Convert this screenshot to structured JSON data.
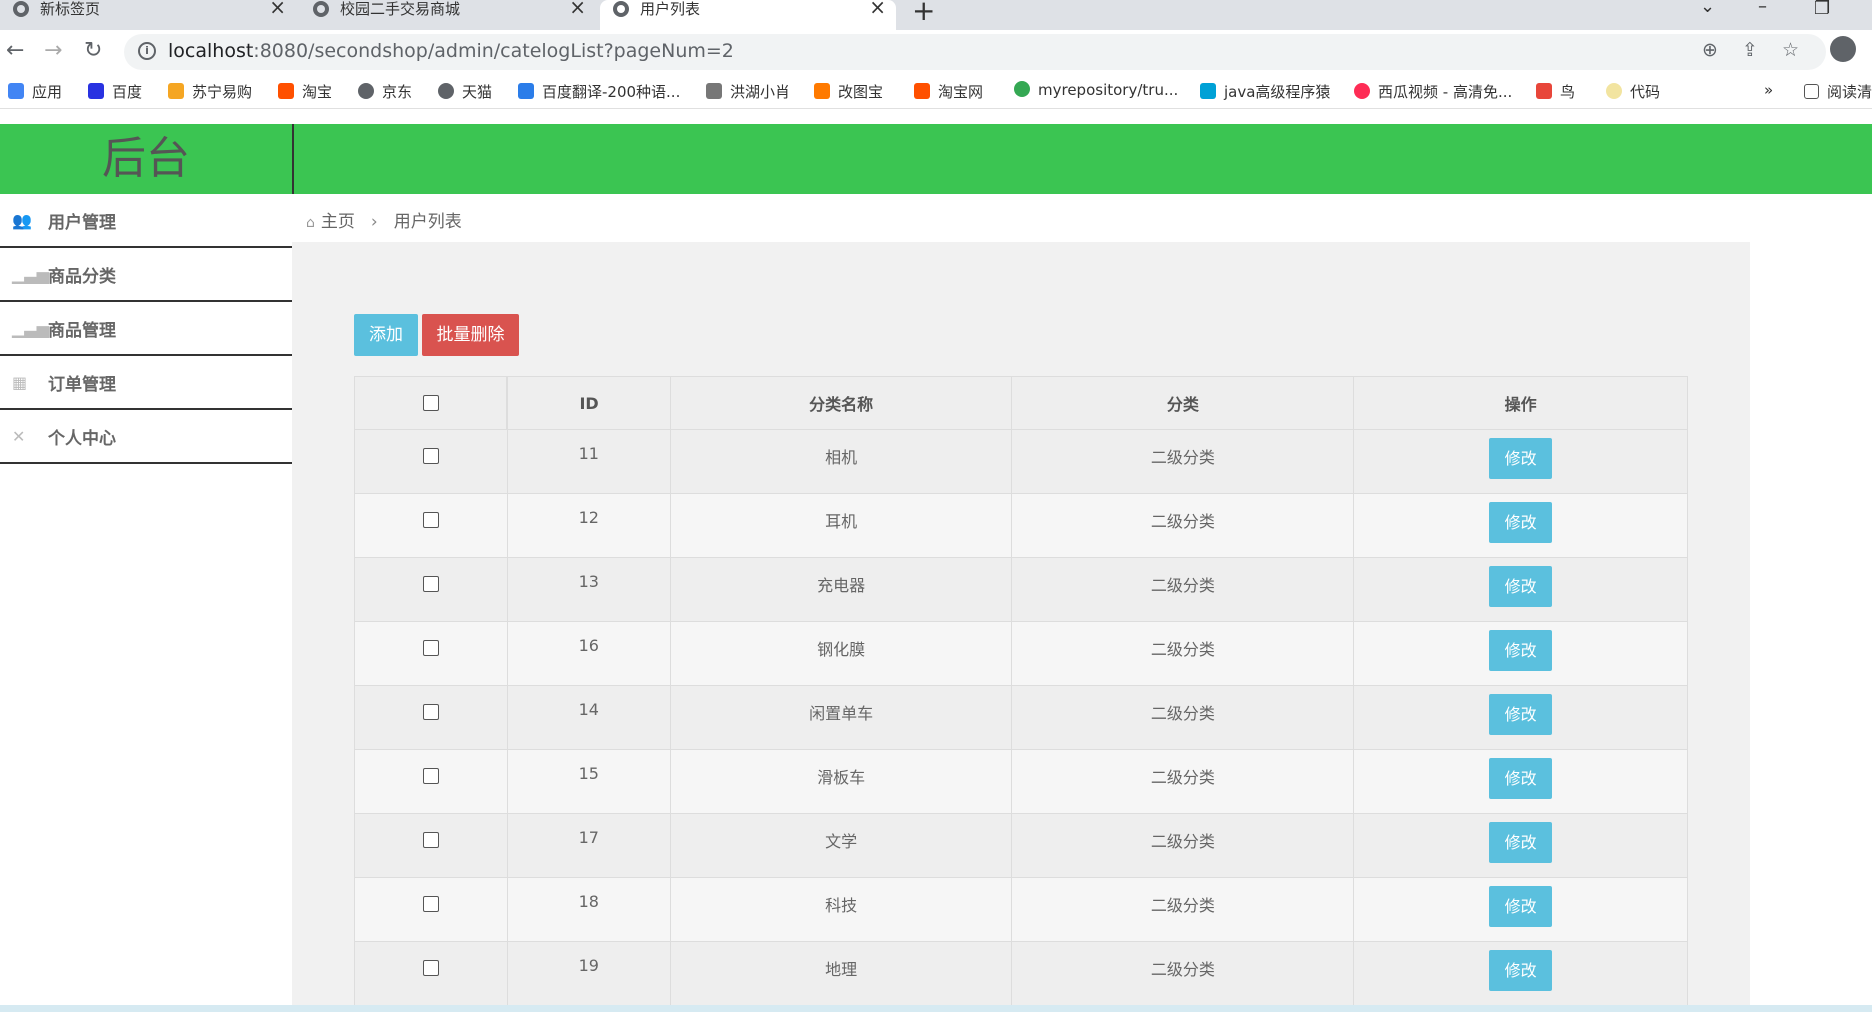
{
  "browser": {
    "tabs": [
      {
        "title": "新标签页",
        "active": false
      },
      {
        "title": "校园二手交易商城",
        "active": false
      },
      {
        "title": "用户列表",
        "active": true
      }
    ],
    "url_host": "localhost",
    "url_rest": ":8080/secondshop/admin/catelogList?pageNum=2",
    "bookmarks": [
      {
        "label": "应用",
        "color": "#4285f4"
      },
      {
        "label": "百度",
        "color": "#2932e1"
      },
      {
        "label": "苏宁易购",
        "color": "#f5a623"
      },
      {
        "label": "淘宝",
        "color": "#ff5000"
      },
      {
        "label": "京东",
        "color": "#5f6368"
      },
      {
        "label": "天猫",
        "color": "#5f6368"
      },
      {
        "label": "百度翻译-200种语...",
        "color": "#2b7de9"
      },
      {
        "label": "洪湖小肖",
        "color": "#777777"
      },
      {
        "label": "改图宝",
        "color": "#ff7a00"
      },
      {
        "label": "淘宝网",
        "color": "#ff5000"
      },
      {
        "label": "myrepository/tru...",
        "color": "#34a853"
      },
      {
        "label": "java高级程序猿",
        "color": "#00a1d6"
      },
      {
        "label": "西瓜视频 - 高清免...",
        "color": "#fe2c55"
      },
      {
        "label": "鸟",
        "color": "#e8463a"
      },
      {
        "label": "代码",
        "color": "#f2e4a0"
      }
    ],
    "more_bookmarks": "»",
    "reading_list": "阅读清"
  },
  "app": {
    "logo": "后台",
    "sidebar": [
      {
        "label": "用户管理",
        "icon": "users-icon"
      },
      {
        "label": "商品分类",
        "icon": "bar-chart-icon"
      },
      {
        "label": "商品管理",
        "icon": "bar-chart-icon"
      },
      {
        "label": "订单管理",
        "icon": "grid-icon"
      },
      {
        "label": "个人中心",
        "icon": "arrows-icon"
      }
    ],
    "breadcrumb": {
      "home": "主页",
      "current": "用户列表"
    },
    "buttons": {
      "add": "添加",
      "batch_delete": "批量删除"
    },
    "table": {
      "headers": [
        "ID",
        "分类名称",
        "分类",
        "操作"
      ],
      "edit_label": "修改",
      "rows": [
        {
          "id": "11",
          "name": "相机",
          "type": "二级分类"
        },
        {
          "id": "12",
          "name": "耳机",
          "type": "二级分类"
        },
        {
          "id": "13",
          "name": "充电器",
          "type": "二级分类"
        },
        {
          "id": "16",
          "name": "钢化膜",
          "type": "二级分类"
        },
        {
          "id": "14",
          "name": "闲置单车",
          "type": "二级分类"
        },
        {
          "id": "15",
          "name": "滑板车",
          "type": "二级分类"
        },
        {
          "id": "17",
          "name": "文学",
          "type": "二级分类"
        },
        {
          "id": "18",
          "name": "科技",
          "type": "二级分类"
        },
        {
          "id": "19",
          "name": "地理",
          "type": "二级分类"
        }
      ]
    }
  },
  "colors": {
    "header_green": "#3bc552",
    "info_blue": "#5bc0de",
    "danger_red": "#d9534f"
  }
}
